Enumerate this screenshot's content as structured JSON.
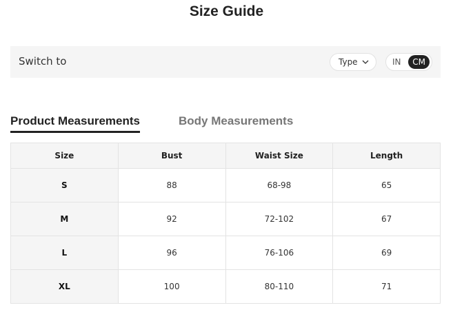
{
  "title": "Size Guide",
  "switch_bar": {
    "label": "Switch to",
    "type_select": "Type",
    "units": [
      "IN",
      "CM"
    ],
    "active_unit": "CM"
  },
  "tabs": [
    {
      "label": "Product Measurements",
      "active": true
    },
    {
      "label": "Body Measurements",
      "active": false
    }
  ],
  "table": {
    "headers": [
      "Size",
      "Bust",
      "Waist Size",
      "Length"
    ],
    "rows": [
      [
        "S",
        "88",
        "68-98",
        "65"
      ],
      [
        "M",
        "92",
        "72-102",
        "67"
      ],
      [
        "L",
        "96",
        "76-106",
        "69"
      ],
      [
        "XL",
        "100",
        "80-110",
        "71"
      ]
    ]
  },
  "colors": {
    "bar_bg": "#f5f5f5",
    "active_unit_bg": "#222222",
    "inactive_tab": "#767676"
  },
  "icons": {
    "type_select": "chevron-down-icon"
  }
}
